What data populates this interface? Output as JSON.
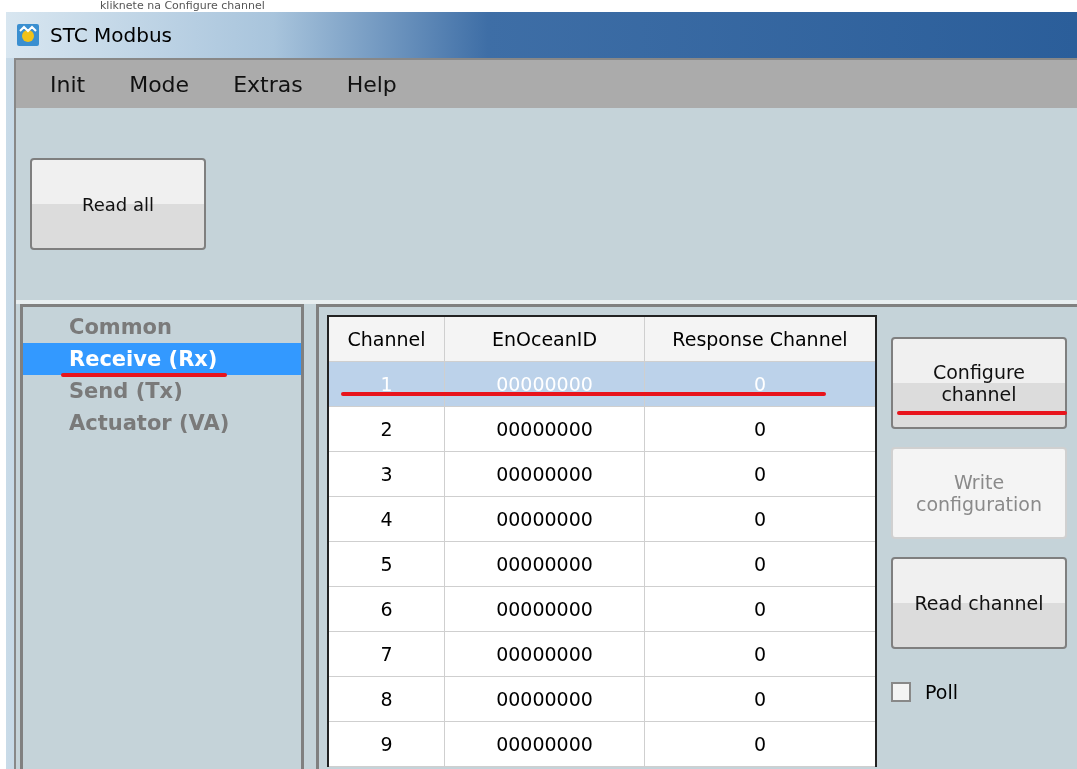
{
  "caption": "kliknete na Configure channel",
  "window": {
    "title": "STC Modbus"
  },
  "menu": [
    "Init",
    "Mode",
    "Extras",
    "Help"
  ],
  "toolbar": {
    "read_all": "Read all"
  },
  "sidebar": {
    "items": [
      {
        "label": "Common",
        "selected": false
      },
      {
        "label": "Receive (Rx)",
        "selected": true
      },
      {
        "label": "Send (Tx)",
        "selected": false
      },
      {
        "label": "Actuator (VA)",
        "selected": false
      }
    ]
  },
  "table": {
    "columns": [
      "Channel",
      "EnOceanID",
      "Response Channel"
    ],
    "rows": [
      {
        "cells": [
          "1",
          "00000000",
          "0"
        ],
        "selected": true
      },
      {
        "cells": [
          "2",
          "00000000",
          "0"
        ],
        "selected": false
      },
      {
        "cells": [
          "3",
          "00000000",
          "0"
        ],
        "selected": false
      },
      {
        "cells": [
          "4",
          "00000000",
          "0"
        ],
        "selected": false
      },
      {
        "cells": [
          "5",
          "00000000",
          "0"
        ],
        "selected": false
      },
      {
        "cells": [
          "6",
          "00000000",
          "0"
        ],
        "selected": false
      },
      {
        "cells": [
          "7",
          "00000000",
          "0"
        ],
        "selected": false
      },
      {
        "cells": [
          "8",
          "00000000",
          "0"
        ],
        "selected": false
      },
      {
        "cells": [
          "9",
          "00000000",
          "0"
        ],
        "selected": false
      }
    ]
  },
  "actions": [
    {
      "label": "Configure channel",
      "disabled": false
    },
    {
      "label": "Write configuration",
      "disabled": true
    },
    {
      "label": "Read channel",
      "disabled": false
    }
  ],
  "poll": {
    "label": "Poll",
    "checked": false
  }
}
